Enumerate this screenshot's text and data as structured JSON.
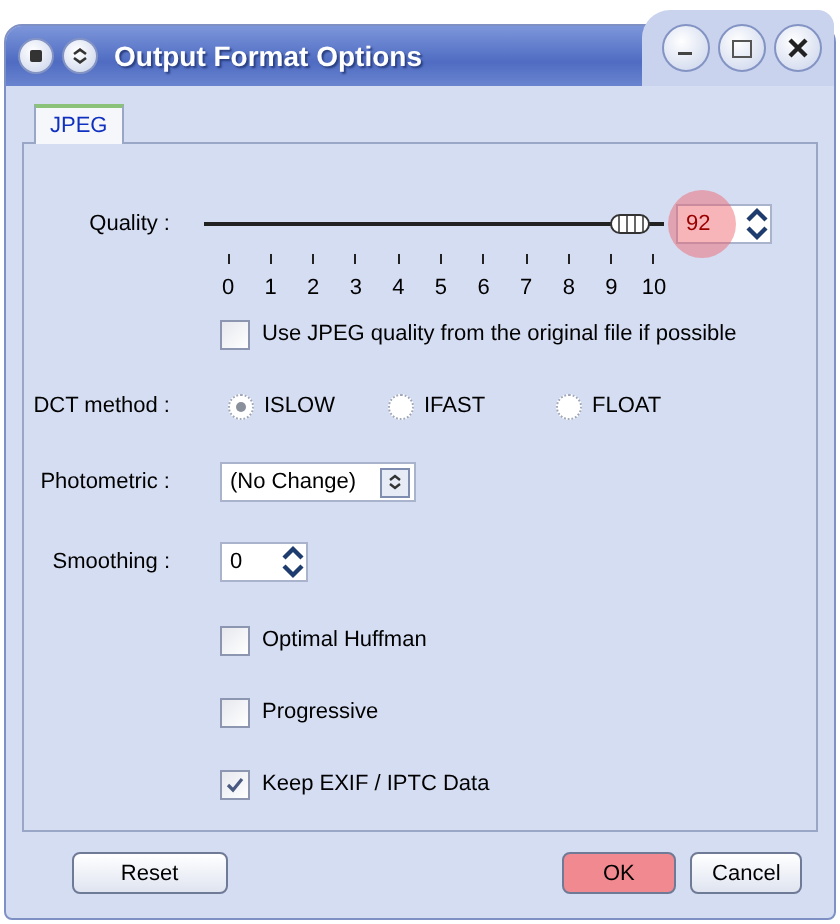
{
  "window": {
    "title": "Output Format Options"
  },
  "tabs": [
    {
      "label": "JPEG",
      "selected": true
    }
  ],
  "quality": {
    "label": "Quality :",
    "level": 0.92,
    "value": "92",
    "highlighted": true,
    "ticks": [
      "0",
      "1",
      "2",
      "3",
      "4",
      "5",
      "6",
      "7",
      "8",
      "9",
      "10"
    ]
  },
  "use_original_quality": {
    "label": "Use JPEG quality from the original file if possible",
    "checked": false
  },
  "dct_method": {
    "label": "DCT method :",
    "options": [
      {
        "label": "ISLOW",
        "selected": true
      },
      {
        "label": "IFAST",
        "selected": false
      },
      {
        "label": "FLOAT",
        "selected": false
      }
    ]
  },
  "photometric": {
    "label": "Photometric :",
    "value": "(No Change)"
  },
  "smoothing": {
    "label": "Smoothing :",
    "value": "0"
  },
  "options": [
    {
      "label": "Optimal Huffman",
      "checked": false
    },
    {
      "label": "Progressive",
      "checked": false
    },
    {
      "label": "Keep EXIF / IPTC Data",
      "checked": true
    }
  ],
  "buttons": [
    {
      "label": "Reset",
      "highlighted": false
    },
    {
      "label": "OK",
      "highlighted": true
    },
    {
      "label": "Cancel",
      "highlighted": false
    }
  ]
}
